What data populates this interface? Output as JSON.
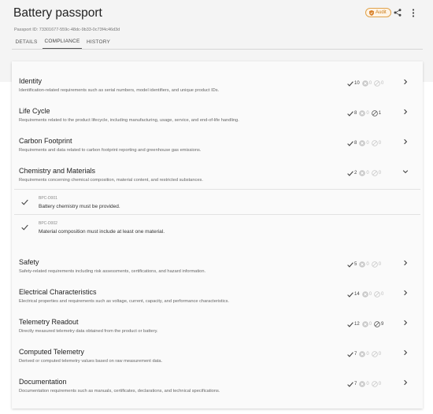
{
  "header": {
    "title": "Battery passport",
    "passport_id": "Passport ID: 73301677-559c-48dc-9b33-0c73f4c46d3d",
    "audit_label": "Audit"
  },
  "tabs": [
    {
      "label": "DETAILS"
    },
    {
      "label": "COMPLIANCE"
    },
    {
      "label": "HISTORY"
    }
  ],
  "sections": [
    {
      "title": "Identity",
      "desc": "Identification-related requirements such as serial numbers, model identifiers, and unique product IDs.",
      "passed": "10",
      "failed": "0",
      "na": "0"
    },
    {
      "title": "Life Cycle",
      "desc": "Requirements related to the product lifecycle, including manufacturing, usage, service, and end-of-life handling.",
      "passed": "8",
      "failed": "0",
      "na": "1"
    },
    {
      "title": "Carbon Footprint",
      "desc": "Requirements and data related to carbon footprint reporting and greenhouse gas emissions.",
      "passed": "8",
      "failed": "0",
      "na": "0"
    },
    {
      "title": "Chemistry and Materials",
      "desc": "Requirements concerning chemical composition, material content, and restricted substances.",
      "passed": "2",
      "failed": "0",
      "na": "0"
    },
    {
      "title": "Safety",
      "desc": "Safety-related requirements including risk assessments, certifications, and hazard information.",
      "passed": "5",
      "failed": "0",
      "na": "0"
    },
    {
      "title": "Electrical Characteristics",
      "desc": "Electrical properties and requirements such as voltage, current, capacity, and performance characteristics.",
      "passed": "14",
      "failed": "0",
      "na": "0"
    },
    {
      "title": "Telemetry Readout",
      "desc": "Directly measured telemetry data obtained from the product or battery.",
      "passed": "12",
      "failed": "0",
      "na": "9"
    },
    {
      "title": "Computed Telemetry",
      "desc": "Derived or computed telemetry values based on raw measurement data.",
      "passed": "7",
      "failed": "0",
      "na": "0"
    },
    {
      "title": "Documentation",
      "desc": "Documentation requirements such as manuals, certificates, declarations, and technical specifications.",
      "passed": "7",
      "failed": "0",
      "na": "0"
    }
  ],
  "requirements": [
    {
      "code": "BPC-D001",
      "text": "Battery chemistry must be provided."
    },
    {
      "code": "BPC-D002",
      "text": "Material composition must include at least one material."
    }
  ],
  "colors": {
    "accent": "#e0a24a",
    "text": "#222222",
    "muted": "#777777"
  }
}
